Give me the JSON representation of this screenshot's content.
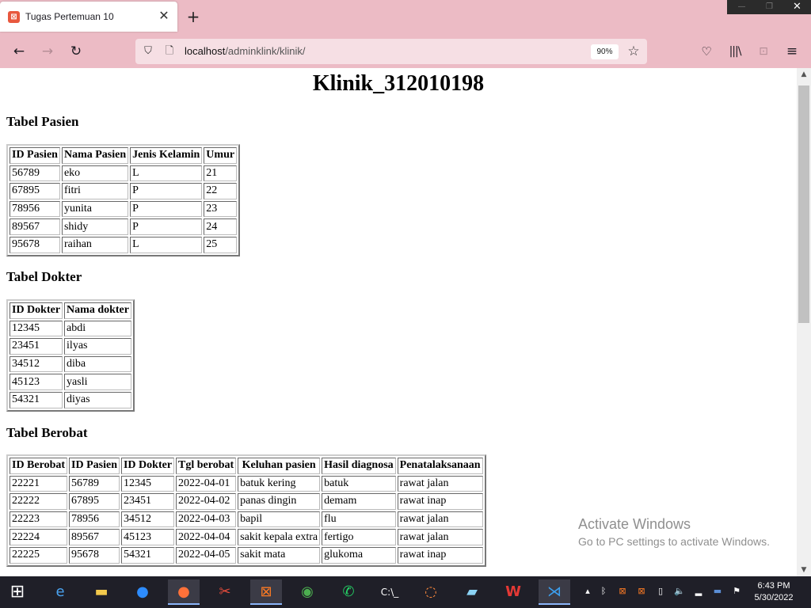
{
  "browser": {
    "tab_title": "Tugas Pertemuan 10",
    "url_host": "localhost",
    "url_path": "/adminklink/klinik/",
    "zoom": "90%"
  },
  "page": {
    "title": "Klinik_312010198",
    "pasien": {
      "heading": "Tabel Pasien",
      "columns": [
        "ID Pasien",
        "Nama Pasien",
        "Jenis Kelamin",
        "Umur"
      ],
      "rows": [
        [
          "56789",
          "eko",
          "L",
          "21"
        ],
        [
          "67895",
          "fitri",
          "P",
          "22"
        ],
        [
          "78956",
          "yunita",
          "P",
          "23"
        ],
        [
          "89567",
          "shidy",
          "P",
          "24"
        ],
        [
          "95678",
          "raihan",
          "L",
          "25"
        ]
      ]
    },
    "dokter": {
      "heading": "Tabel Dokter",
      "columns": [
        "ID Dokter",
        "Nama dokter"
      ],
      "rows": [
        [
          "12345",
          "abdi"
        ],
        [
          "23451",
          "ilyas"
        ],
        [
          "34512",
          "diba"
        ],
        [
          "45123",
          "yasli"
        ],
        [
          "54321",
          "diyas"
        ]
      ]
    },
    "berobat": {
      "heading": "Tabel Berobat",
      "columns": [
        "ID Berobat",
        "ID Pasien",
        "ID Dokter",
        "Tgl berobat",
        "Keluhan pasien",
        "Hasil diagnosa",
        "Penatalaksanaan"
      ],
      "rows": [
        [
          "22221",
          "56789",
          "12345",
          "2022-04-01",
          "batuk kering",
          "batuk",
          "rawat jalan"
        ],
        [
          "22222",
          "67895",
          "23451",
          "2022-04-02",
          "panas dingin",
          "demam",
          "rawat inap"
        ],
        [
          "22223",
          "78956",
          "34512",
          "2022-04-03",
          "bapil",
          "flu",
          "rawat jalan"
        ],
        [
          "22224",
          "89567",
          "45123",
          "2022-04-04",
          "sakit kepala extra",
          "fertigo",
          "rawat jalan"
        ],
        [
          "22225",
          "95678",
          "54321",
          "2022-04-05",
          "sakit mata",
          "glukoma",
          "rawat inap"
        ]
      ]
    }
  },
  "watermark": {
    "line1": "Activate Windows",
    "line2": "Go to PC settings to activate Windows."
  },
  "taskbar": {
    "time": "6:43 PM",
    "date": "5/30/2022",
    "apps": [
      "start-icon",
      "internet-explorer-icon",
      "file-explorer-icon",
      "zoom-icon",
      "firefox-icon",
      "snipping-tool-icon",
      "xampp-icon",
      "chrome-icon",
      "whatsapp-icon",
      "terminal-icon",
      "app-icon",
      "notes-icon",
      "wps-office-icon",
      "vscode-icon"
    ]
  },
  "colors": {
    "chrome_bg": "#ecbbc5",
    "urlbar_bg": "#f6dfe4",
    "taskbar_bg": "#1f1f28"
  }
}
